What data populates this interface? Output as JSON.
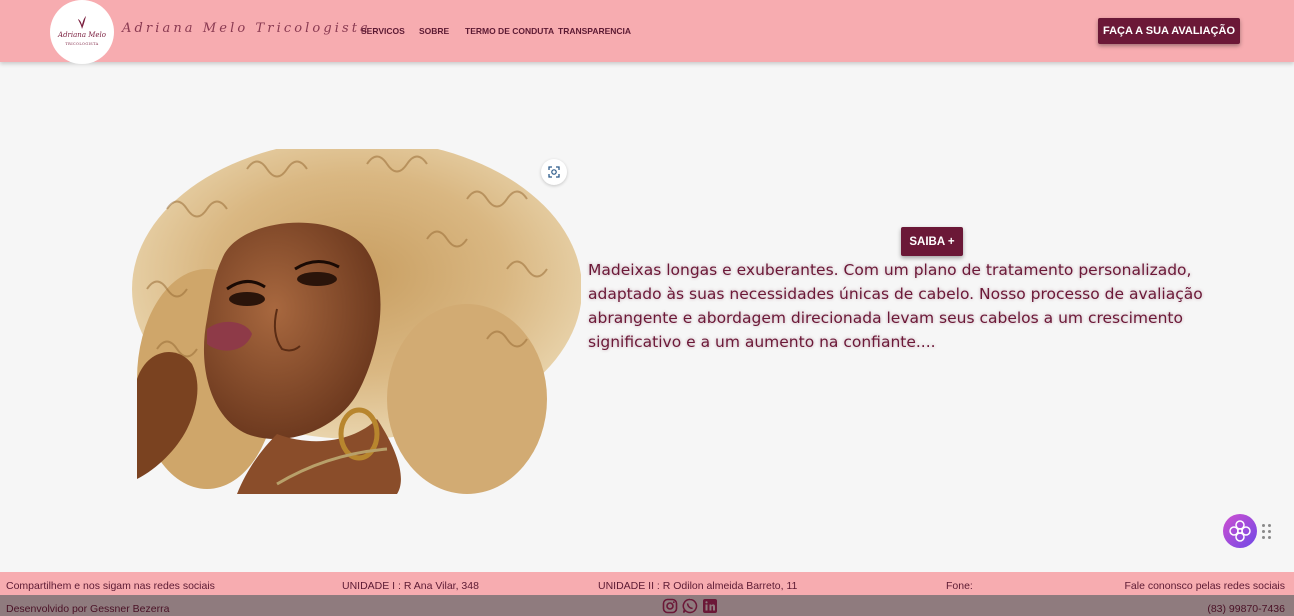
{
  "header": {
    "logo": {
      "line1": "Adriana Melo",
      "line2": "TRICOLOGISTA"
    },
    "brand_name": "Adriana Melo Tricologista",
    "nav": [
      {
        "label": "SERVICOS"
      },
      {
        "label": "SOBRE"
      },
      {
        "label": "TERMO DE CONDUTA"
      },
      {
        "label": "TRANSPARENCIA"
      }
    ],
    "cta_label": "FAÇA A SUA AVALIAÇÃO"
  },
  "hero": {
    "image": "woman-curly-blonde-hair-portrait",
    "zoom_icon": "scan-zoom-icon",
    "saiba_label": "SAIBA +",
    "description": "Madeixas longas e exuberantes. Com um plano de tratamento personalizado, adaptado às suas necessidades únicas de cabelo. Nosso processo de avaliação abrangente e abordagem direcionada levam seus cabelos a um crescimento significativo e a um aumento na confiante...."
  },
  "floating_widget": {
    "icon": "accessibility-flower-icon",
    "handle_icon": "drag-dots-icon"
  },
  "footer": {
    "share_text": "Compartilhem e nos sigam nas redes sociais",
    "unit1": "UNIDADE I : R Ana Vilar, 348",
    "unit2": "UNIDADE II : R Odilon almeida Barreto, 11",
    "phone_label": "Fone:",
    "contact_text": "Fale cononsco pelas redes sociais",
    "developer": "Desenvolvido por Gessner Bezerra",
    "social_icons": [
      "instagram-icon",
      "whatsapp-icon",
      "linkedin-icon"
    ],
    "phone_number": "(83) 99870-7436"
  },
  "colors": {
    "header_bg": "#f7acb0",
    "accent": "#6b1837",
    "footer_bottom_bg": "#8f7b7e",
    "page_bg": "#f6f6f6"
  }
}
